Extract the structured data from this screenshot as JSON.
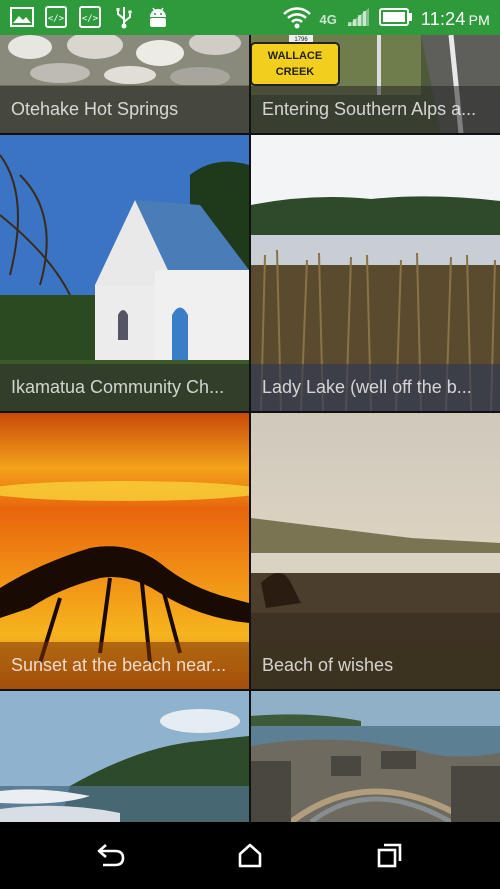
{
  "status_bar": {
    "time": "11:24",
    "ampm": "PM",
    "network": "4G",
    "icons_left": [
      "gallery-icon",
      "code-icon",
      "code-icon",
      "usb-icon",
      "android-icon"
    ],
    "color": "#2e9a3c"
  },
  "tiles": [
    {
      "title": "Otehake Hot Springs",
      "image": "river-rocks"
    },
    {
      "title": "Entering Southern Alps a...",
      "image": "road-sign",
      "sign_line1": "1796",
      "sign_line2": "WALLACE",
      "sign_line3": "CREEK"
    },
    {
      "title": "Ikamatua Community Ch...",
      "image": "white-church"
    },
    {
      "title": "Lady Lake (well off the b...",
      "image": "lake-reeds"
    },
    {
      "title": "Sunset at the beach near...",
      "image": "sunset-driftwood"
    },
    {
      "title": "Beach of wishes",
      "image": "misty-beach"
    },
    {
      "title": "",
      "image": "coast-hills"
    },
    {
      "title": "",
      "image": "pancake-rocks"
    }
  ],
  "nav": {
    "back": "back-icon",
    "home": "home-icon",
    "recents": "recents-icon"
  }
}
